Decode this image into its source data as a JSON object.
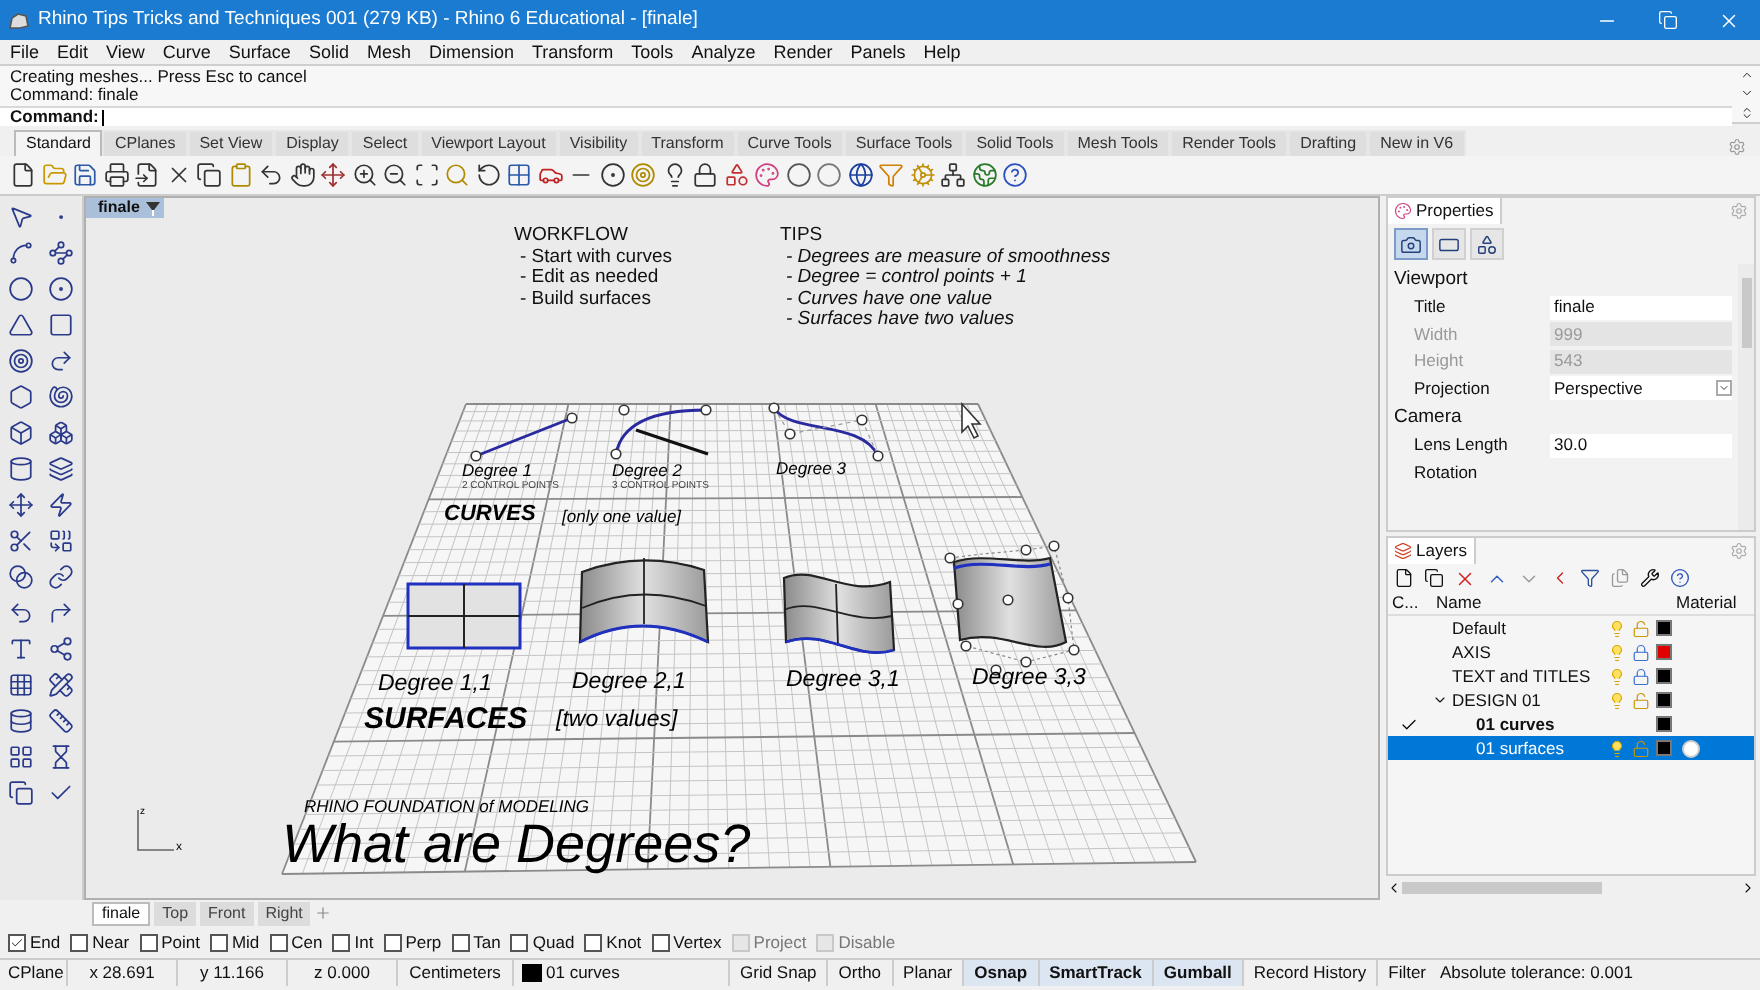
{
  "window": {
    "title": "Rhino Tips Tricks and Techniques 001 (279 KB) - Rhino 6 Educational - [finale]"
  },
  "menu": [
    "File",
    "Edit",
    "View",
    "Curve",
    "Surface",
    "Solid",
    "Mesh",
    "Dimension",
    "Transform",
    "Tools",
    "Analyze",
    "Render",
    "Panels",
    "Help"
  ],
  "command_history": [
    "Creating meshes... Press Esc to cancel",
    "Command: finale"
  ],
  "command_prompt": {
    "label": "Command:"
  },
  "toolbar_tabs": [
    {
      "label": "Standard",
      "selected": true
    },
    {
      "label": "CPlanes",
      "selected": false
    },
    {
      "label": "Set View",
      "selected": false
    },
    {
      "label": "Display",
      "selected": false
    },
    {
      "label": "Select",
      "selected": false
    },
    {
      "label": "Viewport Layout",
      "selected": false
    },
    {
      "label": "Visibility",
      "selected": false
    },
    {
      "label": "Transform",
      "selected": false
    },
    {
      "label": "Curve Tools",
      "selected": false
    },
    {
      "label": "Surface Tools",
      "selected": false
    },
    {
      "label": "Solid Tools",
      "selected": false
    },
    {
      "label": "Mesh Tools",
      "selected": false
    },
    {
      "label": "Render Tools",
      "selected": false
    },
    {
      "label": "Drafting",
      "selected": false
    },
    {
      "label": "New in V6",
      "selected": false
    }
  ],
  "viewport": {
    "tab": "finale",
    "notes": [
      {
        "heading": "WORKFLOW",
        "italic": false,
        "items": [
          "- Start with curves",
          "- Edit as needed",
          "- Build surfaces"
        ]
      },
      {
        "heading": "TIPS",
        "italic": true,
        "items": [
          "- Degrees are measure of smoothness",
          "- Degree = control points + 1",
          "- Curves have one value",
          "- Surfaces have two values"
        ]
      }
    ],
    "curves": {
      "heading": "CURVES",
      "note": "[only one value]",
      "labels": [
        {
          "title": "Degree 1",
          "subtitle": "2 CONTROL POINTS"
        },
        {
          "title": "Degree 2",
          "subtitle": "3 CONTROL POINTS"
        },
        {
          "title": "Degree 3"
        }
      ]
    },
    "surfaces": {
      "heading": "SURFACES",
      "note": "[two values]",
      "labels": [
        "Degree 1,1",
        "Degree 2,1",
        "Degree 3,1",
        "Degree 3,3"
      ]
    },
    "subtitle": "RHINO FOUNDATION of MODELING",
    "title": "What are Degrees?",
    "axes": {
      "vertical": "z",
      "horizontal": "x"
    }
  },
  "viewport_tabs": [
    {
      "label": "finale",
      "selected": true
    },
    {
      "label": "Top",
      "selected": false
    },
    {
      "label": "Front",
      "selected": false
    },
    {
      "label": "Right",
      "selected": false
    }
  ],
  "properties": {
    "title": "Properties",
    "tabs": [
      {
        "kind": "camera",
        "selected": true
      },
      {
        "kind": "rectangle",
        "selected": false
      },
      {
        "kind": "objects",
        "selected": false
      }
    ],
    "sections": [
      {
        "title": "Viewport",
        "rows": [
          {
            "kind": "text",
            "label": "Title",
            "value": "finale",
            "disabled": false
          },
          {
            "kind": "text",
            "label": "Width",
            "value": "999",
            "disabled": true
          },
          {
            "kind": "text",
            "label": "Height",
            "value": "543",
            "disabled": true
          },
          {
            "kind": "dropdown",
            "label": "Projection",
            "value": "Perspective",
            "disabled": false
          }
        ]
      },
      {
        "title": "Camera",
        "rows": [
          {
            "kind": "text",
            "label": "Lens Length",
            "value": "30.0",
            "disabled": false
          },
          {
            "kind": "text",
            "label": "Rotation",
            "disabled": false
          }
        ]
      }
    ]
  },
  "layers": {
    "title": "Layers",
    "columns": [
      "C...",
      "Name",
      "Material"
    ],
    "rows": [
      {
        "name": "Default",
        "color": "#000000",
        "locked": false,
        "current": false,
        "selected": false,
        "has_material": false
      },
      {
        "name": "AXIS",
        "color": "#e00000",
        "locked": true,
        "current": false,
        "selected": false,
        "has_material": false
      },
      {
        "name": "TEXT and TITLES",
        "color": "#000000",
        "locked": true,
        "current": false,
        "selected": false,
        "has_material": false
      },
      {
        "name": "DESIGN 01",
        "color": "#000000",
        "locked": false,
        "current": false,
        "selected": false,
        "has_material": false,
        "expanded": true,
        "children": [
          {
            "name": "01 curves",
            "color": "#000000",
            "current": true,
            "selected": false,
            "has_material": false
          },
          {
            "name": "01 surfaces",
            "color": "#000000",
            "locked": false,
            "current": false,
            "selected": true,
            "has_material": true
          }
        ]
      }
    ]
  },
  "osnaps": [
    {
      "label": "End",
      "checked": true,
      "disabled": false
    },
    {
      "label": "Near",
      "checked": false,
      "disabled": false
    },
    {
      "label": "Point",
      "checked": false,
      "disabled": false
    },
    {
      "label": "Mid",
      "checked": false,
      "disabled": false
    },
    {
      "label": "Cen",
      "checked": false,
      "disabled": false
    },
    {
      "label": "Int",
      "checked": false,
      "disabled": false
    },
    {
      "label": "Perp",
      "checked": false,
      "disabled": false
    },
    {
      "label": "Tan",
      "checked": false,
      "disabled": false
    },
    {
      "label": "Quad",
      "checked": false,
      "disabled": false
    },
    {
      "label": "Knot",
      "checked": false,
      "disabled": false
    },
    {
      "label": "Vertex",
      "checked": false,
      "disabled": false
    },
    {
      "label": "Project",
      "checked": false,
      "disabled": true
    },
    {
      "label": "Disable",
      "checked": false,
      "disabled": true
    }
  ],
  "status_bar": {
    "cplane": "CPlane",
    "coords": [
      "x 28.691",
      "y 11.166",
      "z 0.000"
    ],
    "units": "Centimeters",
    "layer": {
      "name": "01 curves",
      "color": "#000000"
    },
    "toggles": [
      {
        "label": "Grid Snap",
        "on": false
      },
      {
        "label": "Ortho",
        "on": false
      },
      {
        "label": "Planar",
        "on": false
      },
      {
        "label": "Osnap",
        "on": true
      },
      {
        "label": "SmartTrack",
        "on": true
      },
      {
        "label": "Gumball",
        "on": true
      },
      {
        "label": "Record History",
        "on": false
      },
      {
        "label": "Filter",
        "on": false
      }
    ],
    "tolerance": "Absolute tolerance: 0.001"
  }
}
